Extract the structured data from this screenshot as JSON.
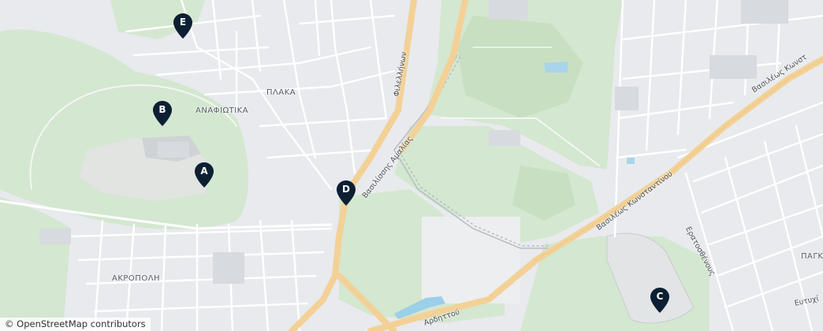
{
  "map": {
    "place_labels": {
      "anafiotika": "ΑΝΑΦΙΩΤΙΚΑ",
      "plaka": "ΠΛΑΚΑ",
      "akropoli": "ΑΚΡΟΠΟΛΗ",
      "pagkrati": "ΠΑΓΚ"
    },
    "road_labels": {
      "filellinon": "Φιλελλήνων",
      "amalias": "Βασιλίσσης Αμαλίας",
      "konstantinou": "Βασιλέως Κωνσταντίνου",
      "konstantinou_ne": "Βασιλέως Κωνστ",
      "ardittou": "Αρδηττού",
      "eratosthenous": "Ερατοσθένους",
      "eftychidou": "Ευτυχί"
    },
    "markers": [
      {
        "letter": "A",
        "color": "#0d1f33"
      },
      {
        "letter": "B",
        "color": "#0d1f33"
      },
      {
        "letter": "C",
        "color": "#0d1f33"
      },
      {
        "letter": "D",
        "color": "#0d1f33"
      },
      {
        "letter": "E",
        "color": "#0d1f33"
      }
    ],
    "attribution": "© OpenStreetMap contributors"
  },
  "colors": {
    "background": "#e9ebee",
    "park": "#d3e6cf",
    "major_road": "#f3d196",
    "minor_road": "#ffffff",
    "water": "#9ccfe8",
    "marker": "#0d1f33"
  }
}
